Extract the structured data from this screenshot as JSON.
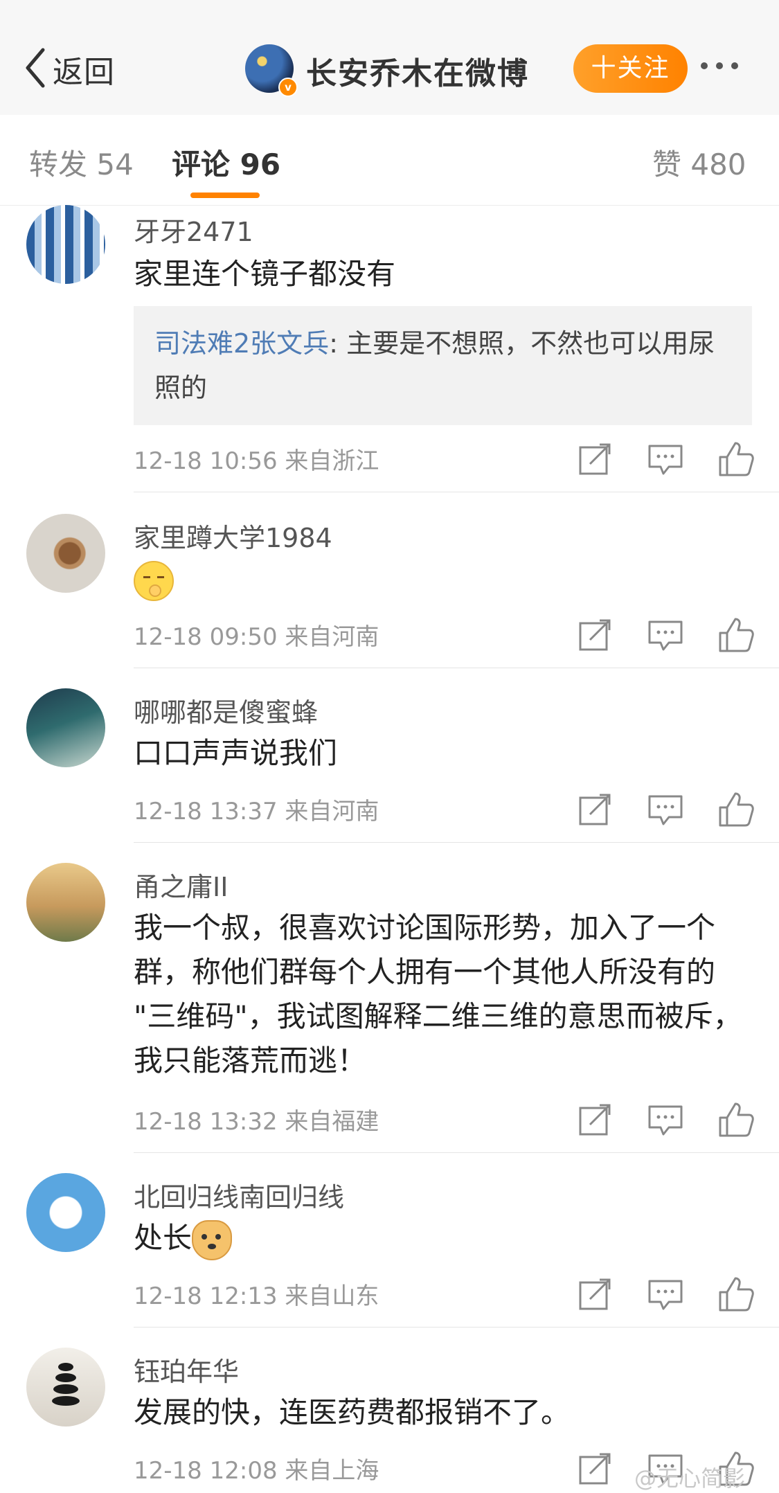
{
  "header": {
    "back_label": "返回",
    "title": "长安乔木在微博",
    "verified_badge": "v",
    "follow_label": "十关注"
  },
  "tabs": {
    "repost": "转发 54",
    "comments": "评论 96",
    "likes": "赞 480"
  },
  "comments": [
    {
      "user": "牙牙2471",
      "text": "家里连个镜子都没有",
      "reply_user": "司法难2张文兵",
      "reply_text": ": 主要是不想照，不然也可以用尿照的",
      "time": "12-18 10:56",
      "location": "来自浙江"
    },
    {
      "user": "家里蹲大学1984",
      "text": "",
      "emoji": "shush-emoji",
      "time": "12-18 09:50",
      "location": "来自河南"
    },
    {
      "user": "哪哪都是傻蜜蜂",
      "text": "口口声声说我们",
      "time": "12-18 13:37",
      "location": "来自河南"
    },
    {
      "user": "甬之庸II",
      "text": "我一个叔，很喜欢讨论国际形势，加入了一个群，称他们群每个人拥有一个其他人所没有的 \"三维码\"，我试图解释二维三维的意思而被斥，我只能落荒而逃！",
      "time": "12-18 13:32",
      "location": "来自福建"
    },
    {
      "user": "北回归线南回归线",
      "text": "处长",
      "emoji": "doge-emoji",
      "time": "12-18 12:13",
      "location": "来自山东"
    },
    {
      "user": "钰珀年华",
      "text": "发展的快，连医药费都报销不了。",
      "time": "12-18 12:08",
      "location": "来自上海"
    }
  ],
  "icons": {
    "back": "chevron-left-icon",
    "more": "more-dots-icon",
    "repost": "repost-icon",
    "comment": "comment-icon",
    "like": "thumbs-up-icon"
  },
  "colors": {
    "accent": "#ff8200",
    "link": "#4f7cb5"
  },
  "watermark": "@无心简影"
}
